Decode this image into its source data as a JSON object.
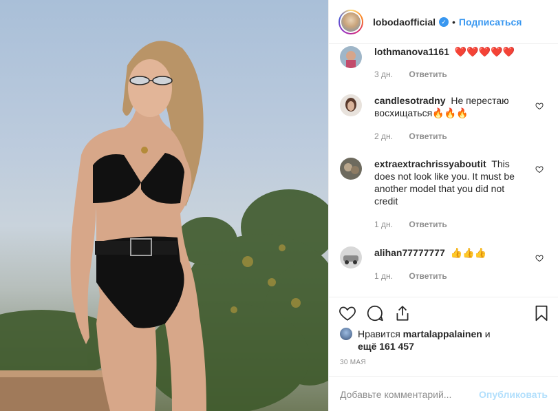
{
  "post": {
    "author": "lobodaofficial",
    "separator": "•",
    "follow_label": "Подписаться",
    "verified_mark": "✓"
  },
  "comments": [
    {
      "user": "lothmanova1161",
      "text": "❤️❤️❤️❤️❤️",
      "time": "3 дн.",
      "reply": "Ответить"
    },
    {
      "user": "candlesotradny",
      "text": "Не перестаю восхищаться🔥🔥🔥",
      "time": "2 дн.",
      "reply": "Ответить"
    },
    {
      "user": "extraextrachrissyaboutit",
      "text": "This does not look like you. It must be another model that you did not credit",
      "time": "1 дн.",
      "reply": "Ответить"
    },
    {
      "user": "alihan77777777",
      "text": "👍👍👍",
      "time": "1 дн.",
      "reply": "Ответить"
    }
  ],
  "likes": {
    "prefix": "Нравится",
    "user": "martalappalainen",
    "conj": "и",
    "rest": "ещё 161 457"
  },
  "date": "30 МАЯ",
  "add_comment": {
    "placeholder": "Добавьте комментарий...",
    "publish_label": "Опубликовать"
  },
  "icons": {
    "like": "heart-icon",
    "comment": "comment-icon",
    "share": "share-icon",
    "save": "bookmark-icon"
  },
  "colors": {
    "accent": "#3897f0",
    "publish_disabled": "#b2dffc",
    "muted": "#8e8e8e",
    "text": "#262626",
    "heart": "#ed4956"
  }
}
